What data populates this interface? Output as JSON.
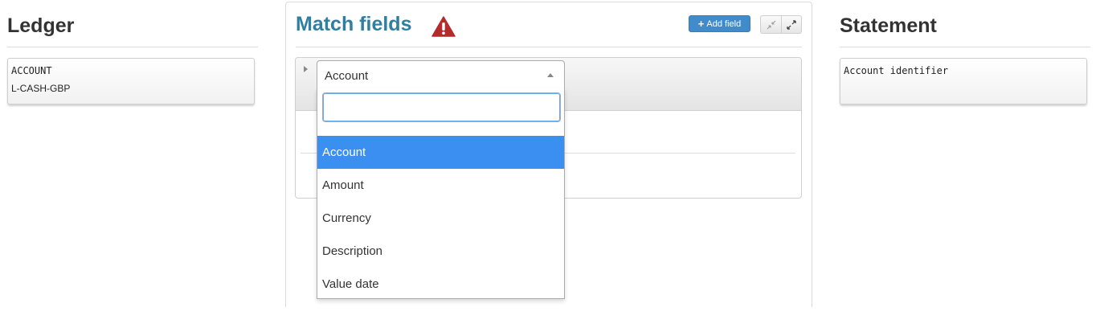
{
  "ledger": {
    "title": "Ledger",
    "field_key": "ACCOUNT",
    "field_value": "L-CASH-GBP"
  },
  "match": {
    "title": "Match fields",
    "add_field_label": "Add field",
    "accent_color": "#2f7fa3",
    "warning_color": "#b52a2a"
  },
  "select": {
    "value": "Account",
    "search_value": "",
    "options": [
      "Account",
      "Amount",
      "Currency",
      "Description",
      "Value date"
    ],
    "selected_option": "Account"
  },
  "statement": {
    "title": "Statement",
    "field_key": "Account identifier"
  },
  "icons": {
    "warning": "warning-triangle-icon",
    "plus": "plus-icon",
    "compress": "compress-icon",
    "expand": "expand-icon",
    "caret": "caret-right-icon",
    "select_arrow": "caret-up-icon"
  }
}
